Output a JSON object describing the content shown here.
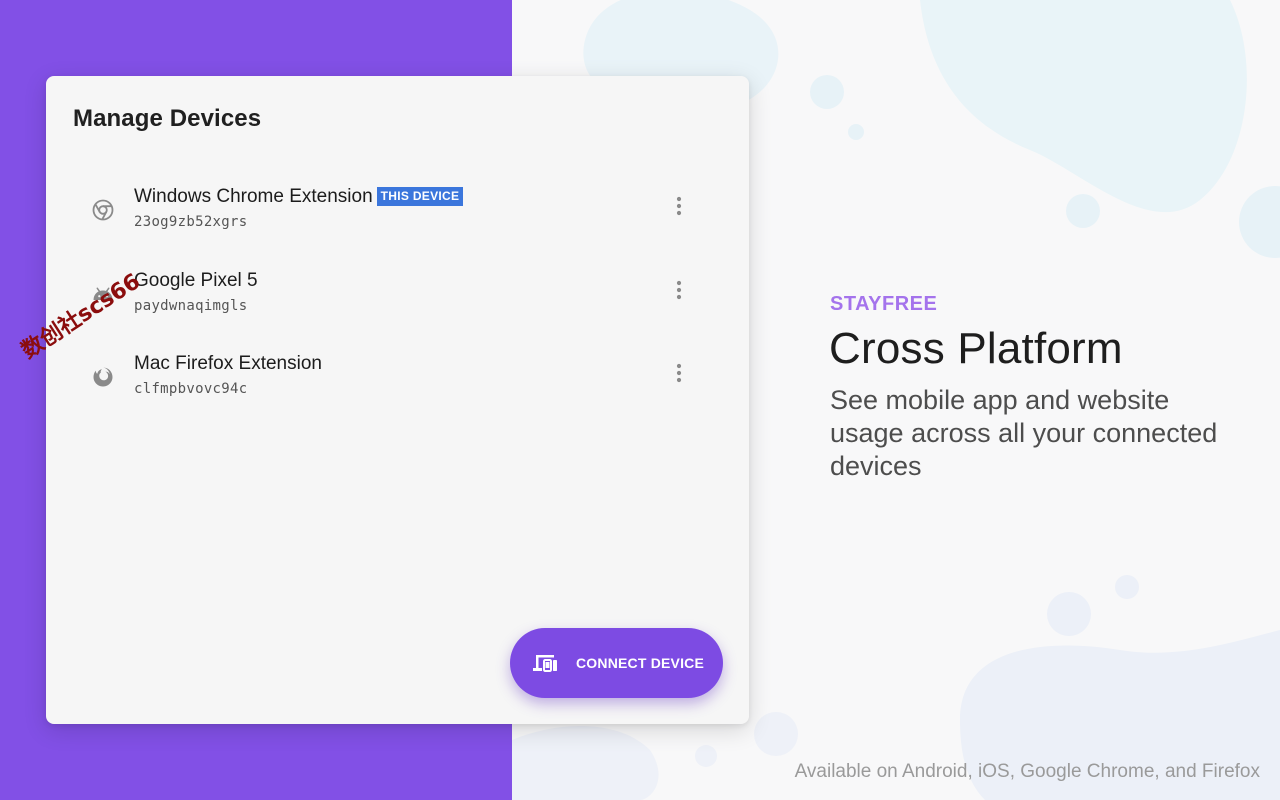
{
  "card": {
    "title": "Manage Devices",
    "devices": [
      {
        "name": "Windows Chrome Extension",
        "badge": "THIS DEVICE",
        "id": "23og9zb52xgrs",
        "icon": "chrome-icon"
      },
      {
        "name": "Google Pixel 5",
        "id": "paydwnaqimgls",
        "icon": "android-icon"
      },
      {
        "name": "Mac Firefox Extension",
        "id": "clfmpbvovc94c",
        "icon": "firefox-icon"
      }
    ],
    "connect_label": "CONNECT DEVICE"
  },
  "hero": {
    "eyebrow": "STAYFREE",
    "headline": "Cross Platform",
    "subtext": "See mobile app and website usage across all your connected devices",
    "footer": "Available on Android, iOS, Google Chrome, and Firefox"
  },
  "watermark": "数创社scs66",
  "colors": {
    "accent": "#8250e6",
    "button": "#7d4be3",
    "eyebrow": "#a473ec",
    "badge": "#3b76dc",
    "background": "#f8f8f9"
  }
}
